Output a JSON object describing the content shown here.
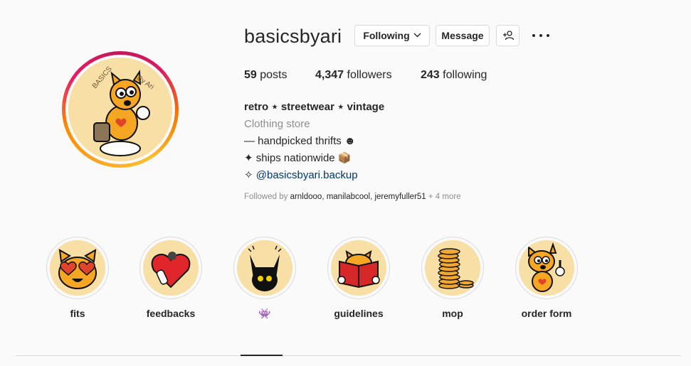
{
  "profile": {
    "username": "basicsbyari",
    "following_button": "Following",
    "message_button": "Message",
    "stats": {
      "posts_count": "59",
      "posts_label": "posts",
      "followers_count": "4,347",
      "followers_label": "followers",
      "following_count": "243",
      "following_label": "following"
    },
    "bio": {
      "name": "retro ⋆ streetwear ⋆ vintage",
      "category": "Clothing store",
      "line1": "— handpicked thrifts ☻",
      "line2": "✦ ships nationwide 📦",
      "line3_prefix": "✧ ",
      "line3_link": "@basicsbyari.backup"
    },
    "followed_by": {
      "prefix": "Followed by ",
      "names": "arnldooo, manilabcool, jeremyfuller51",
      "suffix": " + 4 more"
    }
  },
  "highlights": [
    {
      "label": "fits",
      "icon": "heart-eyes-cat-icon"
    },
    {
      "label": "feedbacks",
      "icon": "heart-cat-icon"
    },
    {
      "label": "👾",
      "icon": "black-cat-icon"
    },
    {
      "label": "guidelines",
      "icon": "reading-cat-icon"
    },
    {
      "label": "mop",
      "icon": "coins-icon"
    },
    {
      "label": "order form",
      "icon": "waving-cat-icon"
    }
  ],
  "colors": {
    "avatar_bg": "#f7dfa6",
    "cat_orange": "#f5a623",
    "link": "#00376b",
    "muted": "#8e8e8e"
  }
}
